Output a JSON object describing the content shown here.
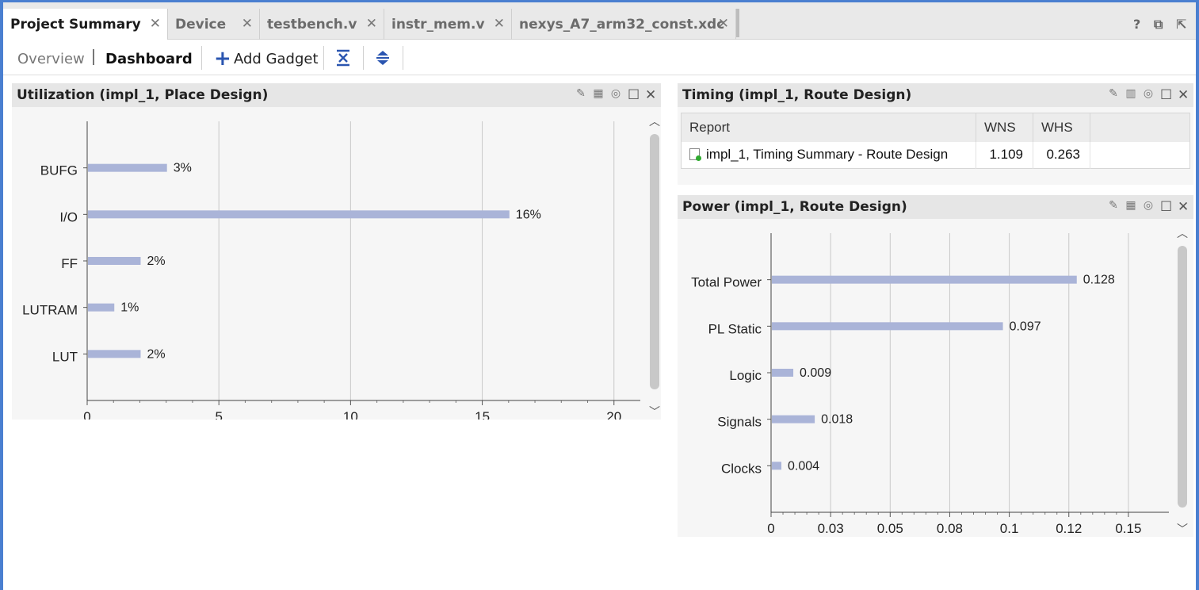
{
  "tabs": [
    {
      "label": "Project Summary",
      "active": true
    },
    {
      "label": "Device",
      "active": false
    },
    {
      "label": "testbench.v",
      "active": false
    },
    {
      "label": "instr_mem.v",
      "active": false
    },
    {
      "label": "nexys_A7_arm32_const.xdc",
      "active": false
    }
  ],
  "window_controls": {
    "help": "?",
    "restore": "⧉",
    "float": "⇱"
  },
  "toolbar": {
    "overview": "Overview",
    "dashboard": "Dashboard",
    "add_gadget": "Add Gadget",
    "add_icon": "+",
    "collapse_icon": "collapse-all-icon",
    "expand_icon": "expand-all-icon"
  },
  "utilization": {
    "title": "Utilization (impl_1, Place Design)",
    "chart_data": {
      "type": "bar",
      "orientation": "horizontal",
      "categories": [
        "BUFG",
        "I/O",
        "FF",
        "LUTRAM",
        "LUT"
      ],
      "values": [
        3,
        16,
        2,
        1,
        2
      ],
      "labels": [
        "3%",
        "16%",
        "2%",
        "1%",
        "2%"
      ],
      "xlim": [
        0,
        21
      ],
      "xticks": [
        0,
        5,
        10,
        15,
        20
      ],
      "xtick_labels": [
        "0",
        "5",
        "10",
        "15",
        "20"
      ],
      "grid": true,
      "bar_color": "#aab4d8"
    }
  },
  "timing": {
    "title": "Timing (impl_1, Route Design)",
    "columns": [
      "Report",
      "WNS",
      "WHS"
    ],
    "rows": [
      {
        "report": "impl_1, Timing Summary - Route Design",
        "wns": "1.109",
        "whs": "0.263"
      }
    ]
  },
  "power": {
    "title": "Power (impl_1, Route Design)",
    "chart_data": {
      "type": "bar",
      "orientation": "horizontal",
      "categories": [
        "Total Power",
        "PL Static",
        "Logic",
        "Signals",
        "Clocks"
      ],
      "values": [
        0.128,
        0.097,
        0.009,
        0.018,
        0.004
      ],
      "labels": [
        "0.128",
        "0.097",
        "0.009",
        "0.018",
        "0.004"
      ],
      "xlim": [
        0,
        0.167
      ],
      "xticks": [
        0,
        0.025,
        0.05,
        0.075,
        0.1,
        0.125,
        0.15
      ],
      "xtick_labels": [
        "0",
        "0.03",
        "0.05",
        "0.08",
        "0.1",
        "0.12",
        "0.15"
      ],
      "grid": true,
      "bar_color": "#aab4d8"
    }
  },
  "colors": {
    "accent_border": "#4a7fd0",
    "bar": "#aab4d8",
    "grid": "#c9c9c9"
  }
}
